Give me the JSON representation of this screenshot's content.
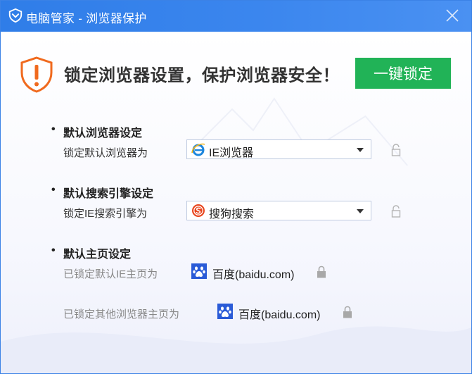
{
  "window": {
    "title": "电脑管家 - 浏览器保护"
  },
  "header": {
    "headline": "锁定浏览器设置，保护浏览器安全！",
    "lock_button": "一键锁定"
  },
  "sections": {
    "browser": {
      "bullet": "•",
      "title": "默认浏览器设定",
      "label": "锁定默认浏览器为",
      "selected": "IE浏览器",
      "icon": "ie-icon"
    },
    "search": {
      "bullet": "•",
      "title": "默认搜索引擎设定",
      "label": "锁定IE搜索引擎为",
      "selected": "搜狗搜索",
      "icon": "sogou-icon"
    },
    "homepage": {
      "bullet": "•",
      "title": "默认主页设定",
      "ie_label": "已锁定默认IE主页为",
      "ie_value": "百度(baidu.com)",
      "other_label": "已锁定其他浏览器主页为",
      "other_value": "百度(baidu.com)",
      "icon": "baidu-paw-icon"
    }
  },
  "colors": {
    "titlebar": "#3b86ee",
    "accent_green": "#21b357",
    "warning_orange": "#f06a1e"
  }
}
